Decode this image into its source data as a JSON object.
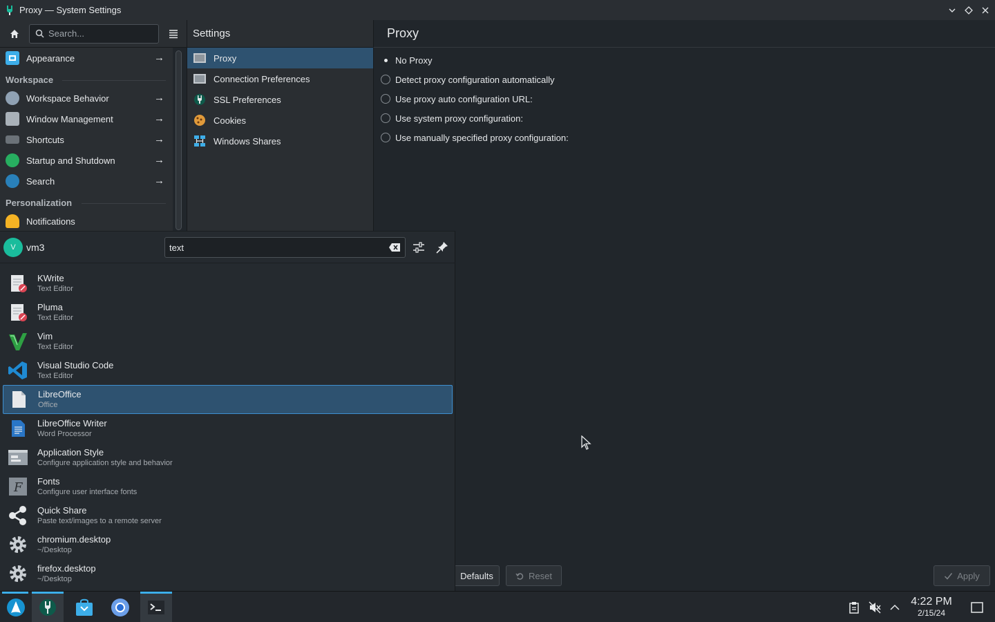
{
  "window": {
    "title": "Proxy — System Settings"
  },
  "toolbar": {
    "search_placeholder": "Search...",
    "col2_title": "Settings",
    "col3_title": "Proxy"
  },
  "sidebar": {
    "items": [
      {
        "label": "Appearance",
        "icon": "appearance-icon",
        "color": "#3daee9"
      },
      {
        "label": "Workspace Behavior",
        "icon": "workspace-behavior-icon",
        "color": "#8fa1b3"
      },
      {
        "label": "Window Management",
        "icon": "window-management-icon",
        "color": "#a9b1b8"
      },
      {
        "label": "Shortcuts",
        "icon": "keyboard-icon",
        "color": "#a9b1b8"
      },
      {
        "label": "Startup and Shutdown",
        "icon": "rocket-icon",
        "color": "#27ae60"
      },
      {
        "label": "Search",
        "icon": "search-icon",
        "color": "#2980b9"
      },
      {
        "label": "Notifications",
        "icon": "bell-icon",
        "color": "#f5b324"
      }
    ],
    "sections": {
      "workspace": "Workspace",
      "personalization": "Personalization"
    }
  },
  "col2": {
    "items": [
      {
        "label": "Proxy"
      },
      {
        "label": "Connection Preferences"
      },
      {
        "label": "SSL Preferences"
      },
      {
        "label": "Cookies"
      },
      {
        "label": "Windows Shares"
      }
    ]
  },
  "proxy": {
    "options": [
      {
        "label": "No Proxy",
        "checked": true
      },
      {
        "label": "Detect proxy configuration automatically",
        "checked": false
      },
      {
        "label": "Use proxy auto configuration URL:",
        "checked": false
      },
      {
        "label": "Use system proxy configuration:",
        "checked": false
      },
      {
        "label": "Use manually specified proxy configuration:",
        "checked": false
      }
    ]
  },
  "footer": {
    "defaults": "Defaults",
    "reset": "Reset",
    "apply": "Apply"
  },
  "launcher": {
    "user": "vm3",
    "avatar_letter": "V",
    "search_value": "text",
    "results": [
      {
        "name": "KWrite",
        "desc": "Text Editor",
        "icon": "kwrite-icon"
      },
      {
        "name": "Pluma",
        "desc": "Text Editor",
        "icon": "pluma-icon"
      },
      {
        "name": "Vim",
        "desc": "Text Editor",
        "icon": "vim-icon"
      },
      {
        "name": "Visual Studio Code",
        "desc": "Text Editor",
        "icon": "vscode-icon"
      },
      {
        "name": "LibreOffice",
        "desc": "Office",
        "icon": "libreoffice-icon",
        "selected": true
      },
      {
        "name": "LibreOffice Writer",
        "desc": "Word Processor",
        "icon": "writer-icon"
      },
      {
        "name": "Application Style",
        "desc": "Configure application style and behavior",
        "icon": "application-style-icon"
      },
      {
        "name": "Fonts",
        "desc": "Configure user interface fonts",
        "icon": "fonts-icon"
      },
      {
        "name": "Quick Share",
        "desc": "Paste text/images to a remote server",
        "icon": "share-icon"
      },
      {
        "name": "chromium.desktop",
        "desc": "~/Desktop",
        "icon": "gear-icon"
      },
      {
        "name": "firefox.desktop",
        "desc": "~/Desktop",
        "icon": "gear-icon"
      }
    ]
  },
  "taskbar": {
    "time": "4:22 PM",
    "date": "2/15/24"
  },
  "colors": {
    "accent": "#3daee9",
    "selection": "#2e5270"
  }
}
